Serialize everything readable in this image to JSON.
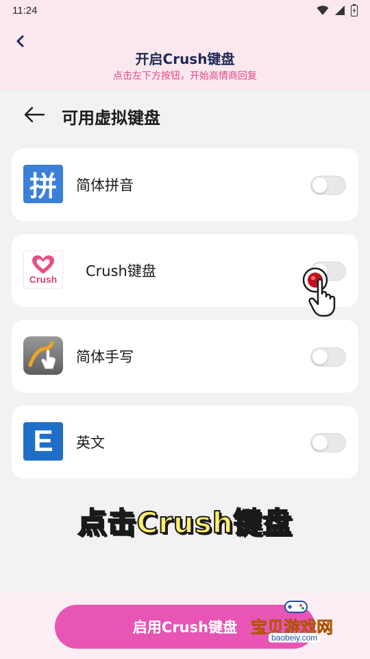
{
  "status_bar": {
    "time": "11:24",
    "icons": [
      "wifi-icon",
      "signal-icon",
      "battery-icon"
    ]
  },
  "header": {
    "title": "开启Crush键盘",
    "subtitle": "点击左下方按钮，开始高情商回复"
  },
  "section": {
    "title": "可用虚拟键盘"
  },
  "keyboards": [
    {
      "label": "简体拼音",
      "icon": "pinyin-icon",
      "icon_glyph": "拼",
      "enabled": false
    },
    {
      "label": "Crush键盘",
      "icon": "crush-heart-icon",
      "icon_word": "Crush",
      "enabled": false
    },
    {
      "label": "简体手写",
      "icon": "handwriting-icon",
      "enabled": false
    },
    {
      "label": "英文",
      "icon": "english-icon",
      "icon_glyph": "E",
      "enabled": false
    }
  ],
  "callout": "点击Crush键盘",
  "enable_button": {
    "label": "启用Crush键盘"
  },
  "watermark": {
    "text": "宝贝游戏网",
    "url": "baobeiy.com"
  },
  "colors": {
    "header_bg": "#fbe8ef",
    "title": "#1e2a57",
    "subtitle": "#e0478a",
    "button": "#e855b5",
    "callout": "#ffef6b",
    "pointer_dot": "#c0101e"
  }
}
